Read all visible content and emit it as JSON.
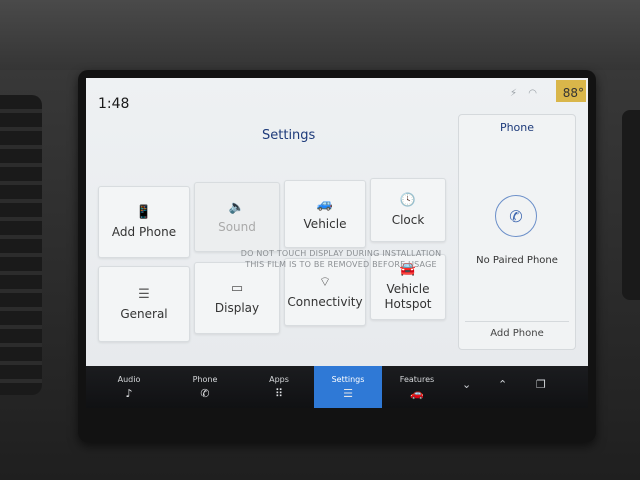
{
  "status": {
    "time": "1:48",
    "temperature": "88°",
    "icons": "⚡ ◠"
  },
  "settings": {
    "title": "Settings"
  },
  "tiles": {
    "add_phone": {
      "label": "Add Phone",
      "icon": "phone-plus-icon"
    },
    "sound": {
      "label": "Sound",
      "icon": "speaker-icon"
    },
    "vehicle": {
      "label": "Vehicle",
      "icon": "vehicle-icon"
    },
    "clock": {
      "label": "Clock",
      "icon": "clock-icon"
    },
    "general": {
      "label": "General",
      "icon": "sliders-icon"
    },
    "display": {
      "label": "Display",
      "icon": "display-icon"
    },
    "connectivity": {
      "label": "Connectivity",
      "icon": "wifi-icon"
    },
    "vehicle_hotspot": {
      "label": "Vehicle\nHotspot",
      "icon": "hotspot-icon"
    }
  },
  "film_notice": {
    "line1": "DO NOT TOUCH DISPLAY DURING INSTALLATION",
    "line2": "THIS FILM IS TO BE REMOVED BEFORE USAGE"
  },
  "phone_panel": {
    "title": "Phone",
    "status": "No Paired Phone",
    "add_button": "Add Phone"
  },
  "nav": {
    "audio": "Audio",
    "phone": "Phone",
    "apps": "Apps",
    "settings": "Settings",
    "features": "Features"
  },
  "colors": {
    "accent": "#2f79d6",
    "title_blue": "#1d3a7a",
    "temp_badge": "#d9b64a"
  }
}
